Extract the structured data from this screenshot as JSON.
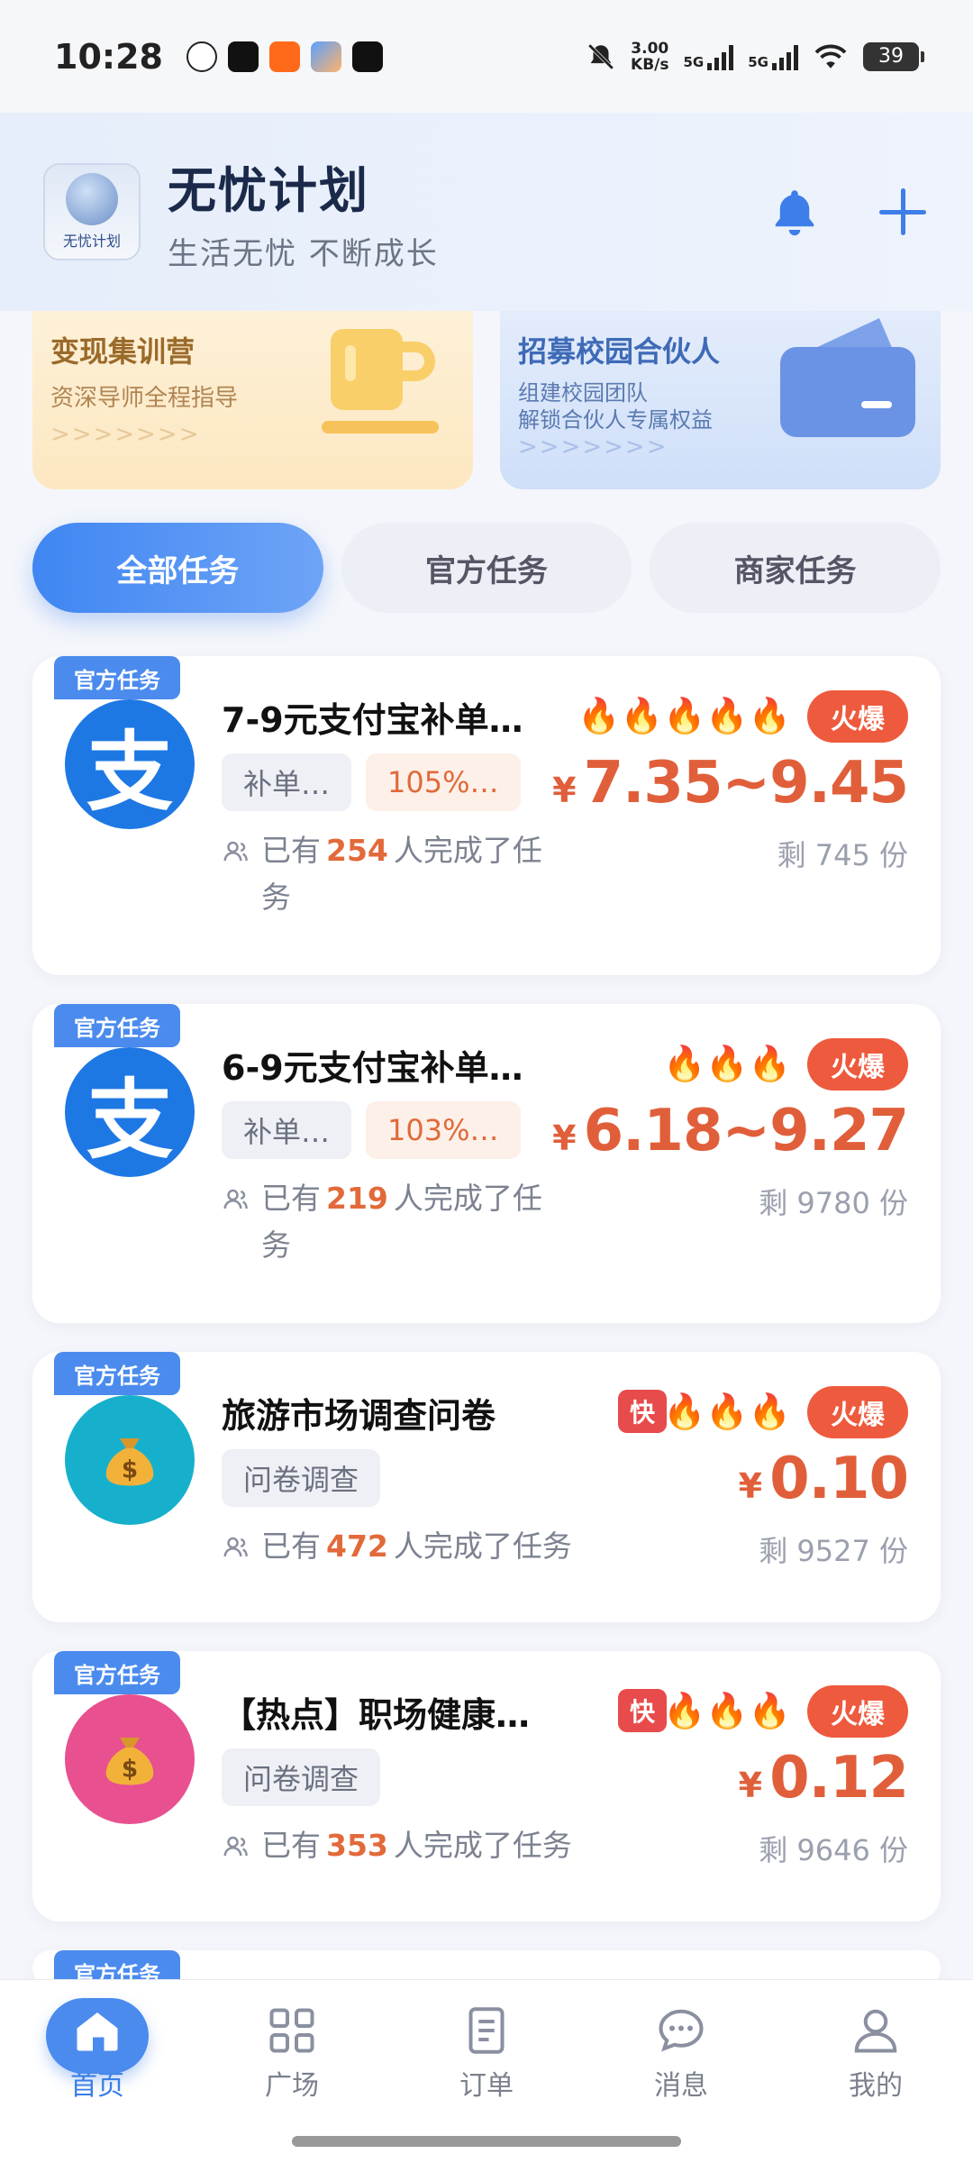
{
  "status": {
    "time": "10:28",
    "net_speed": "3.00",
    "net_unit": "KB/s",
    "sig1": "5G",
    "sig2": "5G",
    "battery": "39"
  },
  "header": {
    "title": "无忧计划",
    "subtitle": "生活无忧 不断成长",
    "logo_text": "无忧计划"
  },
  "banners": [
    {
      "title": "变现集训营",
      "desc": "资深导师全程指导",
      "arrows": ">>>>>>>"
    },
    {
      "title": "招募校园合伙人",
      "desc1": "组建校园团队",
      "desc2": "解锁合伙人专属权益",
      "arrows": ">>>>>>>"
    }
  ],
  "tabs": [
    {
      "label": "全部任务"
    },
    {
      "label": "官方任务"
    },
    {
      "label": "商家任务"
    }
  ],
  "tasks": [
    {
      "tag": "官方任务",
      "avatar_char": "支",
      "title": "7-9元支付宝补单…",
      "chip1": "补单…",
      "chip2": "105%…",
      "done_prefix": "已有",
      "done_count": "254",
      "done_suffix": "人完成了任",
      "done_wrap": "务",
      "flames": "🔥🔥🔥🔥🔥",
      "hot": "火爆",
      "yen": "¥",
      "price": "7.35~9.45",
      "remain": "剩 745 份"
    },
    {
      "tag": "官方任务",
      "avatar_char": "支",
      "title": "6-9元支付宝补单…",
      "chip1": "补单…",
      "chip2": "103%…",
      "done_prefix": "已有",
      "done_count": "219",
      "done_suffix": "人完成了任",
      "done_wrap": "务",
      "flames": "🔥🔥🔥",
      "hot": "火爆",
      "yen": "¥",
      "price": "6.18~9.27",
      "remain": "剩 9780 份"
    },
    {
      "tag": "官方任务",
      "title": "旅游市场调查问卷",
      "quick": "快",
      "chip1": "问卷调查",
      "done_prefix": "已有",
      "done_count": "472",
      "done_suffix": "人完成了任务",
      "flames": "🔥🔥🔥",
      "hot": "火爆",
      "yen": "¥",
      "price": "0.10",
      "remain": "剩 9527 份"
    },
    {
      "tag": "官方任务",
      "title": "【热点】职场健康…",
      "quick": "快",
      "chip1": "问卷调查",
      "done_prefix": "已有",
      "done_count": "353",
      "done_suffix": "人完成了任务",
      "flames": "🔥🔥🔥",
      "hot": "火爆",
      "yen": "¥",
      "price": "0.12",
      "remain": "剩 9646 份"
    },
    {
      "tag": "官方任务"
    }
  ],
  "nav": [
    {
      "label": "首页",
      "icon": "home-icon"
    },
    {
      "label": "广场",
      "icon": "grid-icon"
    },
    {
      "label": "订单",
      "icon": "document-icon"
    },
    {
      "label": "消息",
      "icon": "chat-icon"
    },
    {
      "label": "我的",
      "icon": "user-icon"
    }
  ],
  "colors": {
    "accent": "#3E7EE8",
    "price": "#E05F3A",
    "hot": "#EE5A3D"
  }
}
